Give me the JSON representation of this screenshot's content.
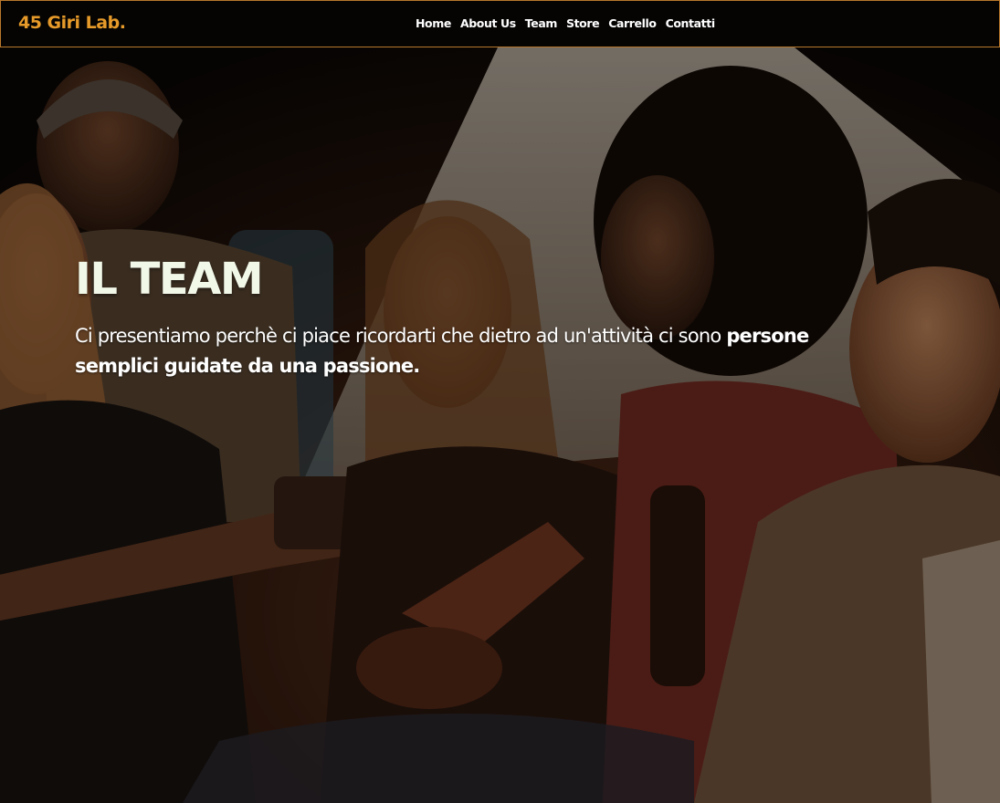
{
  "navbar": {
    "brand": "45 Giri Lab.",
    "links": [
      "Home",
      "About Us",
      "Team",
      "Store",
      "Carrello",
      "Contatti"
    ]
  },
  "hero": {
    "title": "IL TEAM",
    "text_regular": "Ci presentiamo perchè ci piace ricordarti che dietro ad un'attività ci sono ",
    "text_bold": "persone semplici guidate da una passione.",
    "image_description_icon": "group-photo-image"
  },
  "colors": {
    "brand": "#e69a29",
    "nav_border": "#b7782b",
    "nav_bg": "#050403",
    "title": "#f2f8e8"
  }
}
